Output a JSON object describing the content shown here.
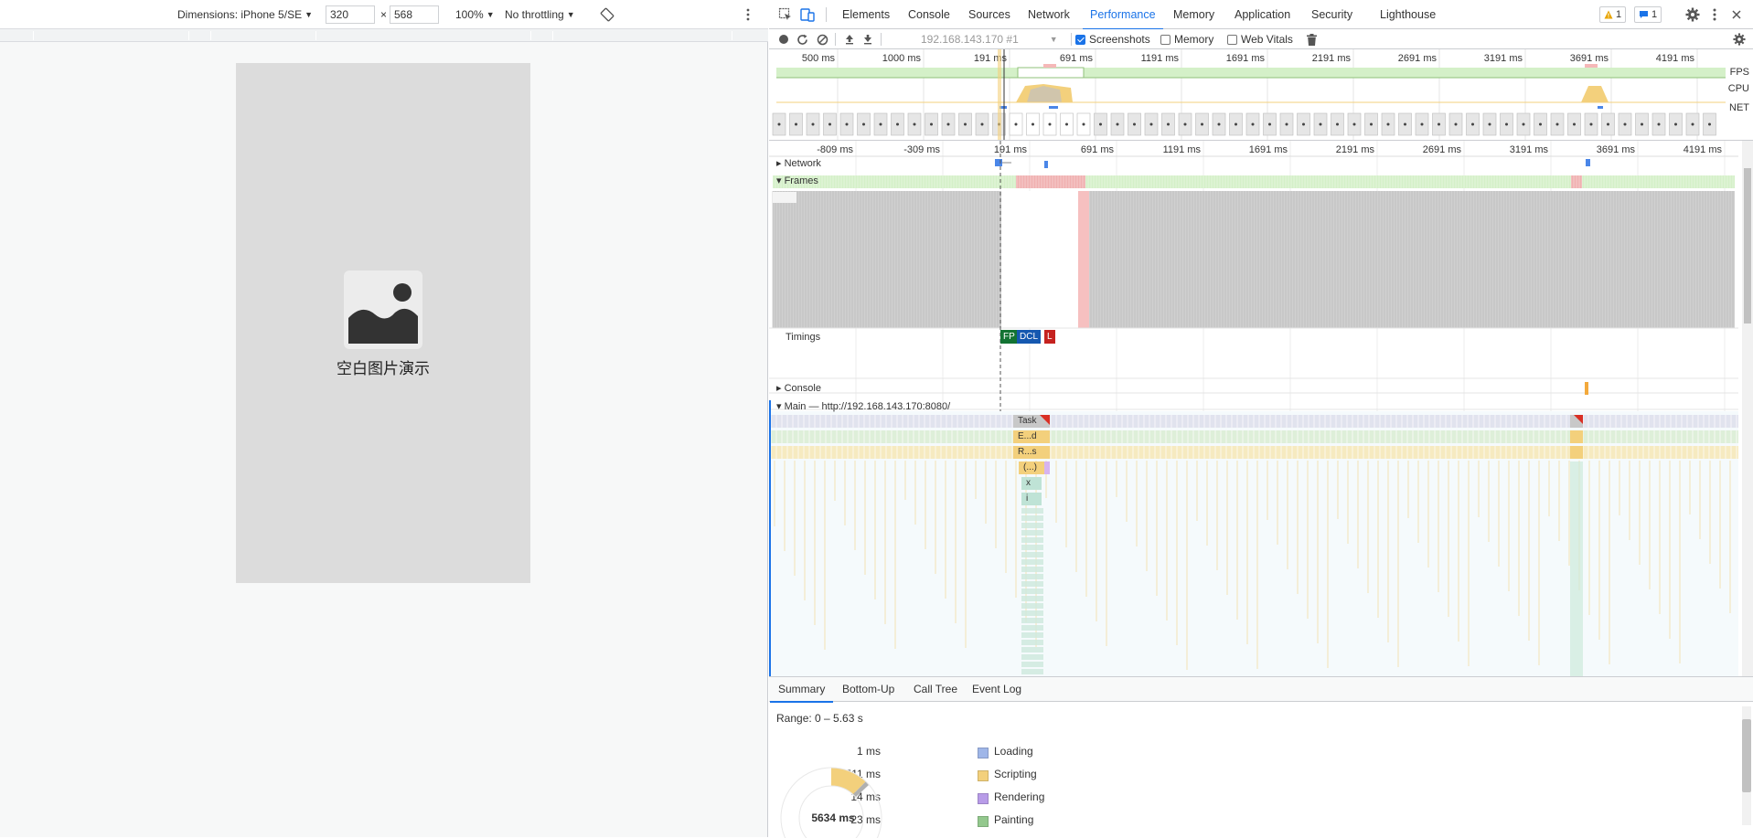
{
  "device_toolbar": {
    "dimensions_label": "Dimensions: iPhone 5/SE",
    "width_value": "320",
    "times": "×",
    "height_value": "568",
    "zoom": "100%",
    "throttling": "No throttling"
  },
  "page": {
    "label": "空白图片演示"
  },
  "devtools": {
    "tabs": [
      "Elements",
      "Console",
      "Sources",
      "Network",
      "Performance",
      "Memory",
      "Application",
      "Security",
      "Lighthouse"
    ],
    "active_tab": "Performance",
    "warnings_count": "1",
    "messages_count": "1"
  },
  "perf_toolbar": {
    "profile_select": "192.168.143.170 #1",
    "screenshots_label": "Screenshots",
    "screenshots_checked": true,
    "memory_label": "Memory",
    "memory_checked": false,
    "webvitals_label": "Web Vitals",
    "webvitals_checked": false
  },
  "overview": {
    "ticks": [
      "500 ms",
      "1000 ms",
      "191 ms",
      "691 ms",
      "1191 ms",
      "1691 ms",
      "2191 ms",
      "2691 ms",
      "3191 ms",
      "3691 ms",
      "4191 ms"
    ],
    "fps_label": "FPS",
    "cpu_label": "CPU",
    "net_label": "NET"
  },
  "timeline": {
    "ticks": [
      "-809 ms",
      "-309 ms",
      "191 ms",
      "691 ms",
      "1191 ms",
      "1691 ms",
      "2191 ms",
      "2691 ms",
      "3191 ms",
      "3691 ms",
      "4191 ms"
    ],
    "tracks": {
      "network": "Network",
      "frames": "Frames",
      "timings": "Timings",
      "console": "Console",
      "main": "Main — http://192.168.143.170:8080/"
    },
    "timing_markers": [
      "FP",
      "DCL",
      "L"
    ],
    "flame_labels": [
      "Task",
      "E...d",
      "R...s",
      "(...)",
      "x",
      "i"
    ]
  },
  "summary": {
    "tabs": [
      "Summary",
      "Bottom-Up",
      "Call Tree",
      "Event Log"
    ],
    "range": "Range: 0 – 5.63 s",
    "items": [
      {
        "value": "1 ms",
        "name": "Loading",
        "color": "#9fb6e8"
      },
      {
        "value": "511 ms",
        "name": "Scripting",
        "color": "#f3d07c"
      },
      {
        "value": "14 ms",
        "name": "Rendering",
        "color": "#b89ce8"
      },
      {
        "value": "23 ms",
        "name": "Painting",
        "color": "#93c88d"
      }
    ],
    "total": "5634 ms"
  },
  "colors": {
    "accent": "#1a73e8",
    "fps_green": "#d4f0c8",
    "cpu_yellow": "#f3d07c",
    "fp": "#137333",
    "dcl": "#1558b0",
    "l": "#c5221f"
  }
}
